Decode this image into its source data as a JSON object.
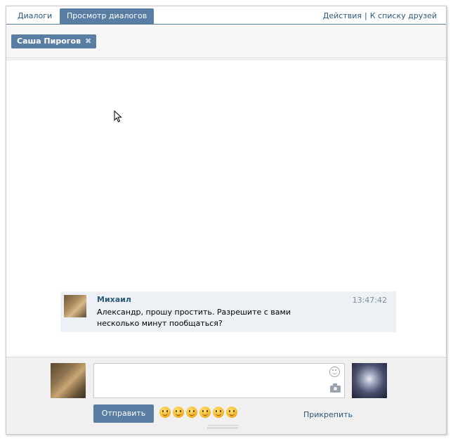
{
  "tabs": [
    {
      "label": "Диалоги",
      "active": false
    },
    {
      "label": "Просмотр диалогов",
      "active": true
    }
  ],
  "top_links": {
    "actions": "Действия",
    "separator": "|",
    "friends": "К списку друзей"
  },
  "recipient": {
    "name": "Саша Пирогов",
    "remove_icon": "close-icon"
  },
  "messages": [
    {
      "author": "Михаил",
      "time": "13:47:42",
      "text": "Александр, прошу простить. Разрешите с вами несколько минут пообщаться?"
    }
  ],
  "composer": {
    "input_value": "",
    "send_label": "Отправить",
    "attach_label": "Прикрепить",
    "icons": [
      "smile-icon",
      "camera-icon"
    ],
    "emoji_count": 6
  },
  "colors": {
    "accent": "#597da3",
    "link": "#2b587a",
    "message_bg": "#edf1f5",
    "time": "#7a8fa5"
  }
}
